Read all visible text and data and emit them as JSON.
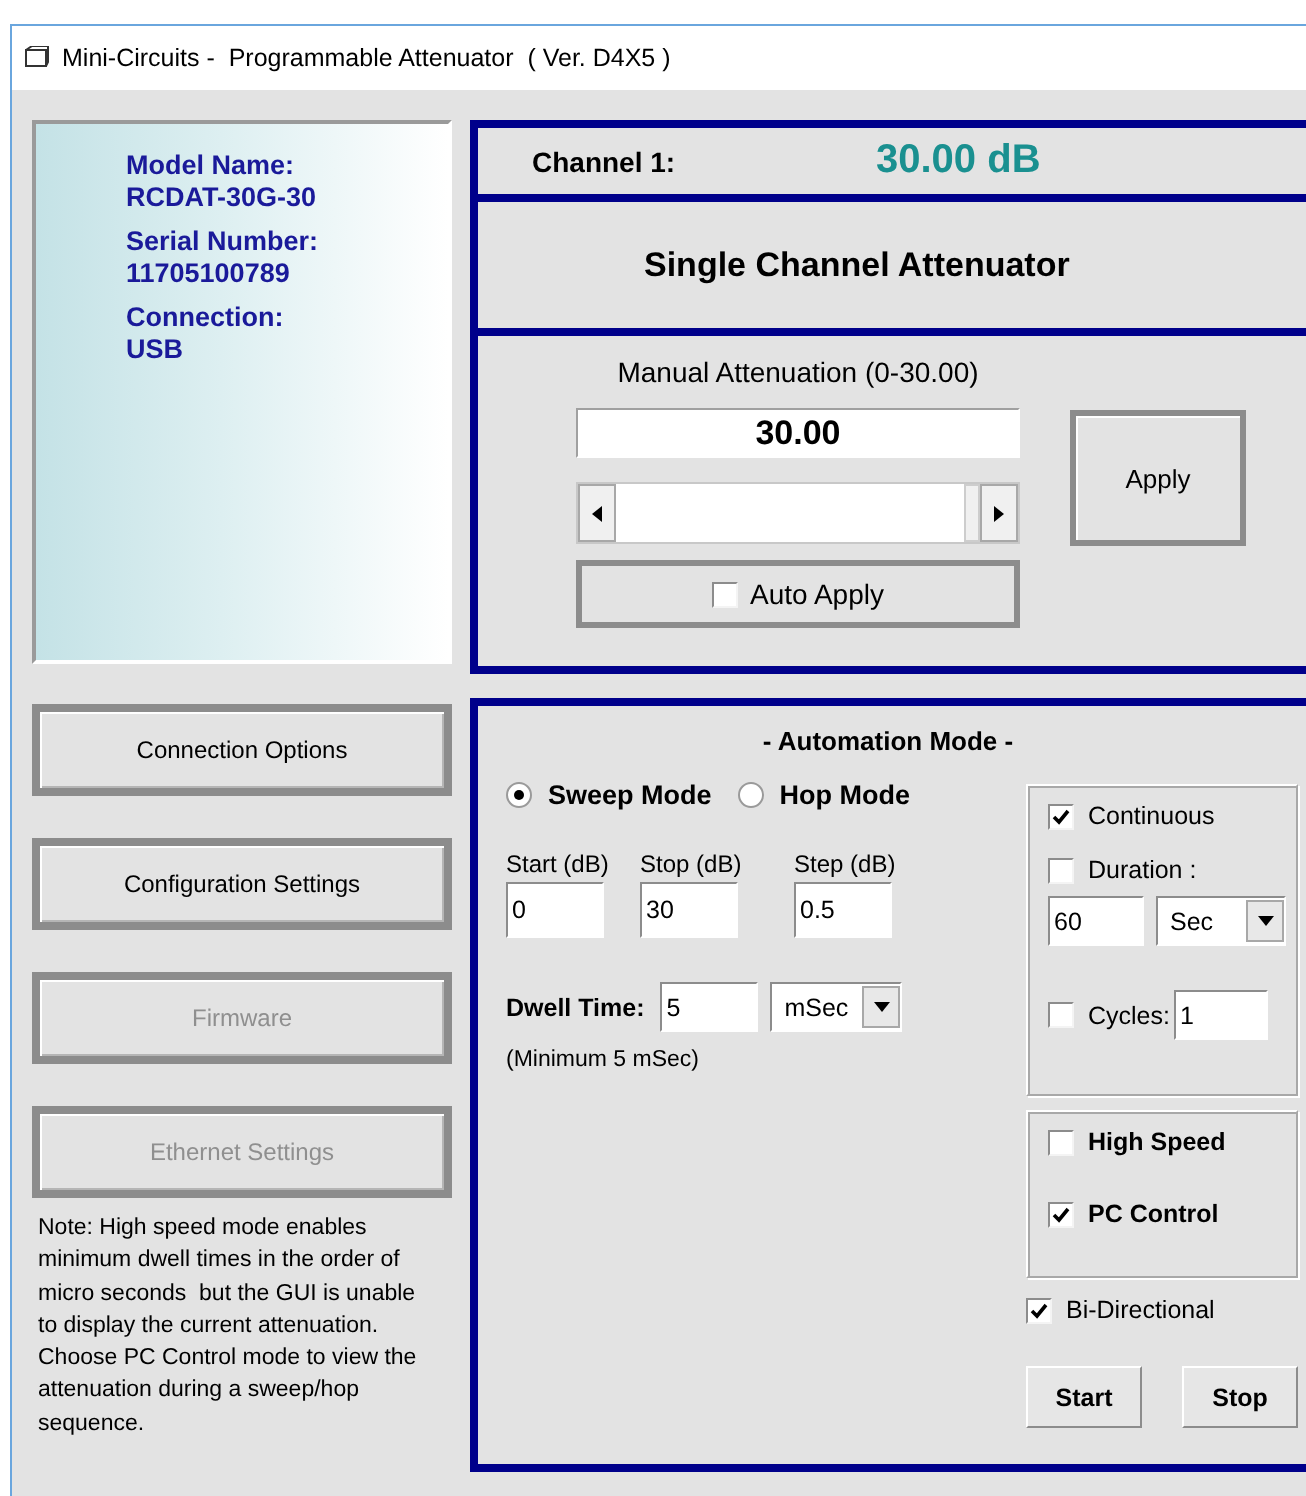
{
  "window": {
    "title": "Mini-Circuits -  Programmable Attenuator  ( Ver. D4X5 )"
  },
  "device_info": [
    {
      "label": "Model Name:",
      "value": "RCDAT-30G-30"
    },
    {
      "label": "Serial Number:",
      "value": "11705100789"
    },
    {
      "label": "Connection:",
      "value": "USB"
    }
  ],
  "side_buttons": [
    {
      "label": "Connection Options",
      "disabled": false
    },
    {
      "label": "Configuration Settings",
      "disabled": false
    },
    {
      "label": "Firmware",
      "disabled": true
    },
    {
      "label": "Ethernet Settings",
      "disabled": true
    }
  ],
  "note": "Note: High speed mode enables minimum dwell times in the order of micro seconds  but the GUI is unable to display the current attenuation. Choose PC Control mode to view the attenuation during a sweep/hop sequence.",
  "channel": {
    "label": "Channel 1:",
    "reading": "30.00 dB"
  },
  "mode_title": "Single Channel Attenuator",
  "manual": {
    "label": "Manual Attenuation (0-30.00)",
    "value": "30.00",
    "apply": "Apply",
    "auto_apply": {
      "label": "Auto Apply",
      "checked": false
    }
  },
  "automation": {
    "title": "- Automation Mode -",
    "modes": [
      {
        "label": "Sweep Mode",
        "selected": true
      },
      {
        "label": "Hop Mode",
        "selected": false
      }
    ],
    "fields": [
      {
        "label": "Start (dB)",
        "value": "0"
      },
      {
        "label": "Stop (dB)",
        "value": "30"
      },
      {
        "label": "Step (dB)",
        "value": "0.5"
      }
    ],
    "dwell": {
      "label": "Dwell Time:",
      "value": "5",
      "unit": "mSec",
      "hint": "(Minimum 5 mSec)"
    },
    "continuous": {
      "label": "Continuous",
      "checked": true
    },
    "duration": {
      "label": "Duration :",
      "checked": false,
      "value": "60",
      "unit": "Sec"
    },
    "cycles": {
      "label": "Cycles:",
      "checked": false,
      "value": "1"
    },
    "high_speed": {
      "label": "High Speed",
      "checked": false
    },
    "pc_control": {
      "label": "PC Control",
      "checked": true
    },
    "bi_directional": {
      "label": "Bi-Directional",
      "checked": true
    },
    "buttons": [
      "Start",
      "Stop"
    ]
  }
}
